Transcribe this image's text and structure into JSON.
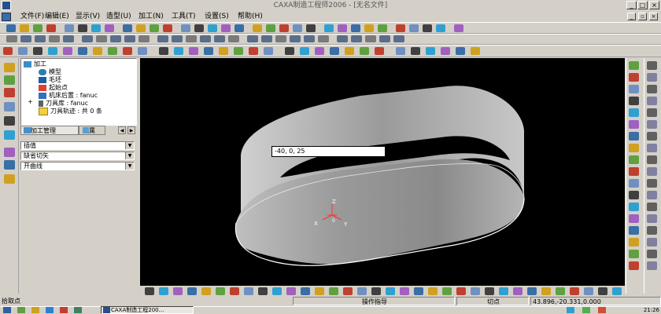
{
  "window": {
    "title": "CAXA制造工程师2006 - [无名文件]",
    "controls": [
      "_",
      "□",
      "×"
    ],
    "mdi_controls": [
      "_",
      "▫",
      "×"
    ]
  },
  "menu": [
    "文件(F)",
    "编辑(E)",
    "显示(V)",
    "造型(U)",
    "加工(N)",
    "工具(T)",
    "设置(S)",
    "帮助(H)"
  ],
  "tree": {
    "items": [
      {
        "label": "加工",
        "icon": "folder-icon",
        "indent": 0
      },
      {
        "label": "模型",
        "icon": "model-icon",
        "indent": 1
      },
      {
        "label": "毛坯",
        "icon": "blank-icon",
        "indent": 1
      },
      {
        "label": "起始点",
        "icon": "start-point-icon",
        "indent": 1
      },
      {
        "label": "机床后置 : fanuc",
        "icon": "machine-icon",
        "indent": 1
      },
      {
        "label": "刀具库 : fanuc",
        "icon": "tool-library-icon",
        "indent": 1
      },
      {
        "label": "刀具轨迹 : 共 0 条",
        "icon": "toolpath-icon",
        "indent": 1
      }
    ],
    "tabs": [
      "加工管理",
      "属"
    ]
  },
  "properties": {
    "dropdowns": [
      "插值",
      "缺省切矢",
      "开曲线"
    ]
  },
  "viewport": {
    "coordinate_input": "-40, 0, 25",
    "axis_labels": {
      "z": "Z",
      "x": "X",
      "y": "Y",
      "origin": "0"
    }
  },
  "status": {
    "prompt": "拾取点",
    "operation_hint": "操作指导",
    "snap_mode": "切点",
    "coordinates": "43.896,-20.331,0.000"
  },
  "taskbar": {
    "task": "CAXA制造工程200...",
    "clock": "21:26"
  }
}
